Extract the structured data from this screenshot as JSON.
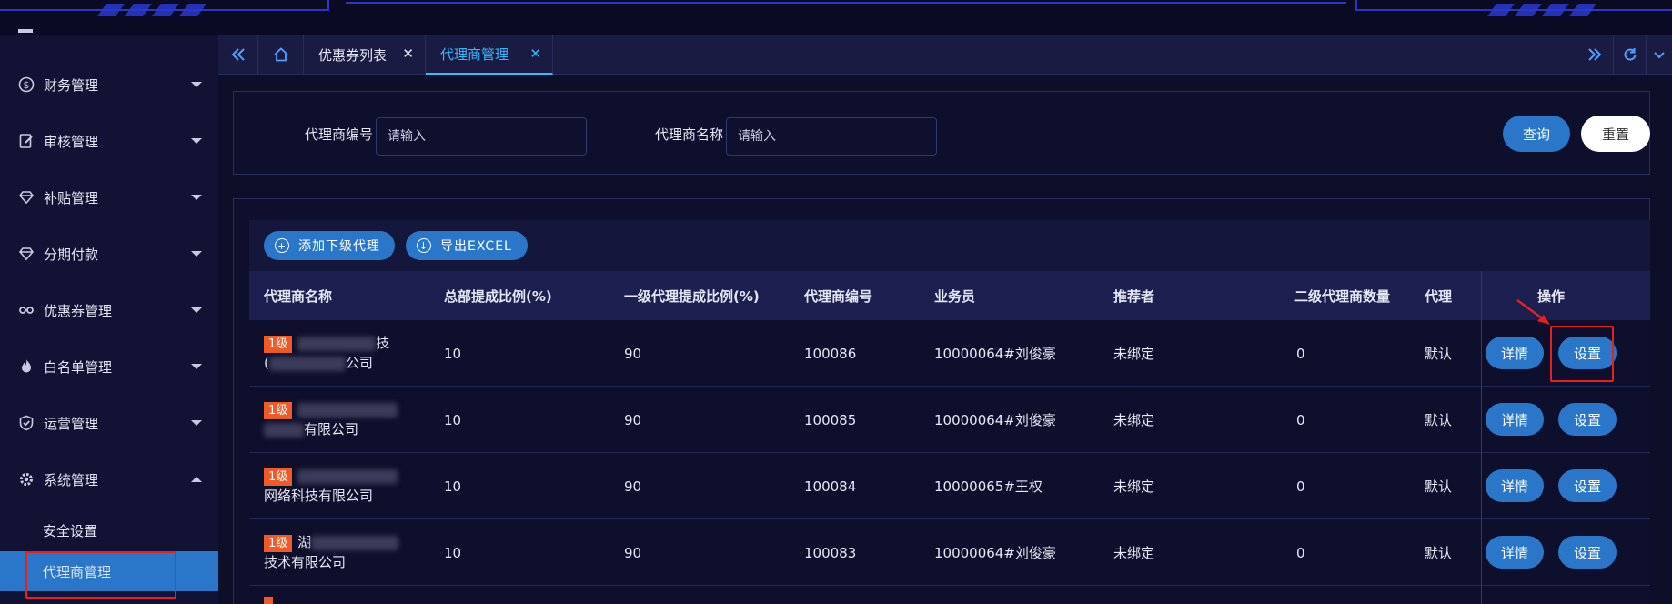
{
  "sidebar": {
    "items": [
      {
        "label": "财务管理",
        "icon": "dollar-circle-icon"
      },
      {
        "label": "审核管理",
        "icon": "audit-icon"
      },
      {
        "label": "补贴管理",
        "icon": "diamond-icon"
      },
      {
        "label": "分期付款",
        "icon": "diamond-icon"
      },
      {
        "label": "优惠券管理",
        "icon": "coupon-icon"
      },
      {
        "label": "白名单管理",
        "icon": "fire-icon"
      },
      {
        "label": "运营管理",
        "icon": "shield-icon"
      },
      {
        "label": "系统管理",
        "icon": "gear-icon"
      }
    ],
    "sub_items": [
      {
        "label": "安全设置"
      },
      {
        "label": "代理商管理"
      }
    ]
  },
  "tabs": [
    {
      "label": "优惠券列表",
      "close": "✕"
    },
    {
      "label": "代理商管理",
      "close": "✕"
    }
  ],
  "filters": {
    "agent_code_label": "代理商编号",
    "agent_code_placeholder": "请输入",
    "agent_name_label": "代理商名称",
    "agent_name_placeholder": "请输入",
    "query_button": "查询",
    "reset_button": "重置"
  },
  "toolbar": {
    "add_sub_agent": "添加下级代理",
    "export_excel": "导出EXCEL"
  },
  "table": {
    "columns": [
      "代理商名称",
      "总部提成比例(%)",
      "一级代理提成比例(%)",
      "代理商编号",
      "业务员",
      "推荐者",
      "二级代理商数量",
      "代理",
      "操作"
    ],
    "rows": [
      {
        "level": "1级",
        "name_line1": "技",
        "name_line2": "公司",
        "hq_ratio": "10",
        "l1_ratio": "90",
        "code": "100086",
        "salesman": "10000064#刘俊豪",
        "referrer": "未绑定",
        "sub_count": "0",
        "agent_type": "默认",
        "detail": "详情",
        "settings": "设置"
      },
      {
        "level": "1级",
        "name_line1": "",
        "name_line2": "有限公司",
        "hq_ratio": "10",
        "l1_ratio": "90",
        "code": "100085",
        "salesman": "10000064#刘俊豪",
        "referrer": "未绑定",
        "sub_count": "0",
        "agent_type": "默认",
        "detail": "详情",
        "settings": "设置"
      },
      {
        "level": "1级",
        "name_line1": "",
        "name_line2": "网络科技有限公司",
        "hq_ratio": "10",
        "l1_ratio": "90",
        "code": "100084",
        "salesman": "10000065#王权",
        "referrer": "未绑定",
        "sub_count": "0",
        "agent_type": "默认",
        "detail": "详情",
        "settings": "设置"
      },
      {
        "level": "1级",
        "name_line1": "湖",
        "name_line2": "技术有限公司",
        "hq_ratio": "10",
        "l1_ratio": "90",
        "code": "100083",
        "salesman": "10000064#刘俊豪",
        "referrer": "未绑定",
        "sub_count": "0",
        "agent_type": "默认",
        "detail": "详情",
        "settings": "设置"
      }
    ]
  },
  "colors": {
    "accent": "#2a77ca",
    "highlight": "#e81f1f",
    "level_badge": "#f05a28",
    "tab_active": "#38b8ff"
  }
}
